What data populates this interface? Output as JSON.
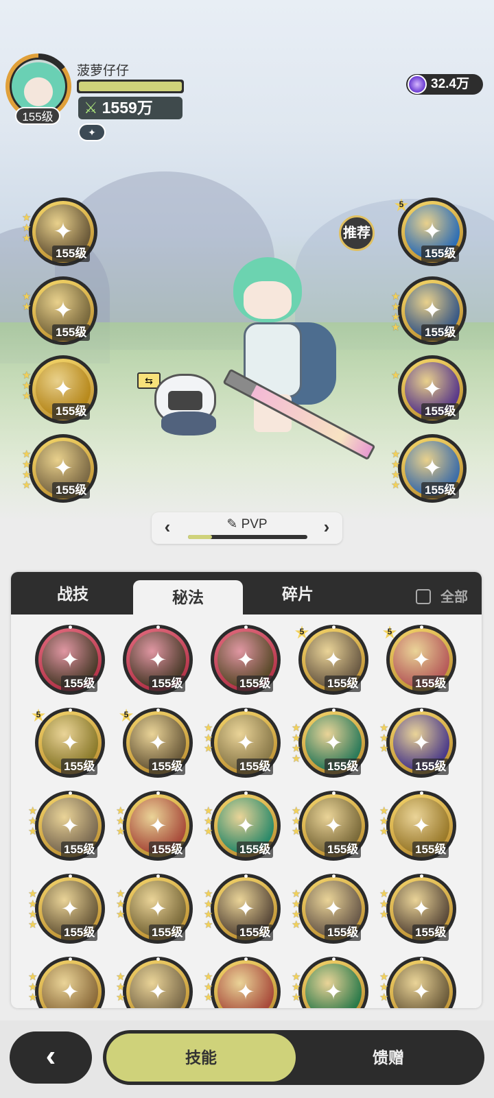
{
  "player": {
    "name": "菠萝仔仔",
    "level": "155级",
    "power": "1559万",
    "hp_fraction": 1.0
  },
  "currency": {
    "value": "32.4万",
    "icon": "purple-gem-icon"
  },
  "recommend_label": "推荐",
  "equipped_left": [
    {
      "icon": "strike-icon",
      "level": "155级",
      "stars": 3,
      "color": "#6b5a3a"
    },
    {
      "icon": "slash-icon",
      "level": "155级",
      "stars": 2,
      "color": "#7a6a3e"
    },
    {
      "icon": "rune-icon",
      "level": "155级",
      "stars": 3,
      "color": "#b88a1c"
    },
    {
      "icon": "whirlwind-icon",
      "level": "155级",
      "stars": 4,
      "color": "#7d6b46"
    }
  ],
  "equipped_right": [
    {
      "icon": "snowflake-icon",
      "level": "155级",
      "stars": 5,
      "color": "#2f6fb5"
    },
    {
      "icon": "ice-crystal-icon",
      "level": "155级",
      "stars": 4,
      "color": "#3a5a86"
    },
    {
      "icon": "shadow-wolf-icon",
      "level": "155级",
      "stars": 1,
      "color": "#5a3a8a"
    },
    {
      "icon": "ice-shield-icon",
      "level": "155级",
      "stars": 4,
      "color": "#3e6ea8"
    }
  ],
  "mode": {
    "label": "PVP",
    "progress": 0.2
  },
  "tabs": [
    "战技",
    "秘法",
    "碎片"
  ],
  "active_tab": 1,
  "all_label": "全部",
  "grid": [
    {
      "icon": "claw-icon",
      "level": "155级",
      "stars": 0,
      "red": true,
      "color": "#4a3b2a"
    },
    {
      "icon": "vortex-icon",
      "level": "155级",
      "stars": 0,
      "red": true,
      "color": "#4a3b2a"
    },
    {
      "icon": "shield-icon",
      "level": "155级",
      "stars": 0,
      "red": true,
      "color": "#5a4a2a"
    },
    {
      "icon": "dagger-icon",
      "level": "155级",
      "stars": 5,
      "red": false,
      "color": "#6a5a44"
    },
    {
      "icon": "sword-heal-icon",
      "level": "155级",
      "stars": 5,
      "red": false,
      "color": "#b65a5a"
    },
    {
      "icon": "hexagon-icon",
      "level": "155级",
      "stars": 5,
      "red": false,
      "color": "#8a7a2a"
    },
    {
      "icon": "team-icon",
      "level": "155级",
      "stars": 5,
      "red": false,
      "color": "#6a5a3a"
    },
    {
      "icon": "eye-icon",
      "level": "155级",
      "stars": 3,
      "red": false,
      "color": "#8a7a4a"
    },
    {
      "icon": "heart-heal-icon",
      "level": "155级",
      "stars": 4,
      "red": false,
      "color": "#2a7a5a"
    },
    {
      "icon": "panther-icon",
      "level": "155级",
      "stars": 3,
      "red": false,
      "color": "#4a3a8a"
    },
    {
      "icon": "sword-up-icon",
      "level": "155级",
      "stars": 3,
      "red": false,
      "color": "#7a6a52"
    },
    {
      "icon": "orb-icon",
      "level": "155级",
      "stars": 3,
      "red": false,
      "color": "#a84a3a"
    },
    {
      "icon": "green-blade-icon",
      "level": "155级",
      "stars": 3,
      "red": false,
      "color": "#2a8a6a"
    },
    {
      "icon": "golem-icon",
      "level": "155级",
      "stars": 3,
      "red": false,
      "color": "#7a6a3a"
    },
    {
      "icon": "ring-icon",
      "level": "155级",
      "stars": 3,
      "red": false,
      "color": "#9a7a2a"
    },
    {
      "icon": "helmet-icon",
      "level": "155级",
      "stars": 4,
      "red": false,
      "color": "#6a5a3a"
    },
    {
      "icon": "armor-icon",
      "level": "155级",
      "stars": 3,
      "red": false,
      "color": "#7a6a3a"
    },
    {
      "icon": "dagger-slash-icon",
      "level": "155级",
      "stars": 4,
      "red": false,
      "color": "#5a4a3a"
    },
    {
      "icon": "sword-down-icon",
      "level": "155级",
      "stars": 4,
      "red": false,
      "color": "#6a5a4a"
    },
    {
      "icon": "heart-shield-icon",
      "level": "155级",
      "stars": 3,
      "red": false,
      "color": "#5a4a3a"
    },
    {
      "icon": "sun-icon",
      "level": "",
      "stars": 3,
      "red": false,
      "color": "#8a6a3a"
    },
    {
      "icon": "wings-icon",
      "level": "",
      "stars": 3,
      "red": false,
      "color": "#7a6a4a"
    },
    {
      "icon": "red-shield-icon",
      "level": "",
      "stars": 3,
      "red": false,
      "color": "#a84a3a"
    },
    {
      "icon": "green-cross-icon",
      "level": "",
      "stars": 3,
      "red": false,
      "color": "#2a7a4a"
    },
    {
      "icon": "user-plus-icon",
      "level": "",
      "stars": 3,
      "red": false,
      "color": "#6a5a3a"
    }
  ],
  "bottom": {
    "back_icon": "back-arrow-icon",
    "skill_label": "技能",
    "gift_label": "馈赠"
  }
}
